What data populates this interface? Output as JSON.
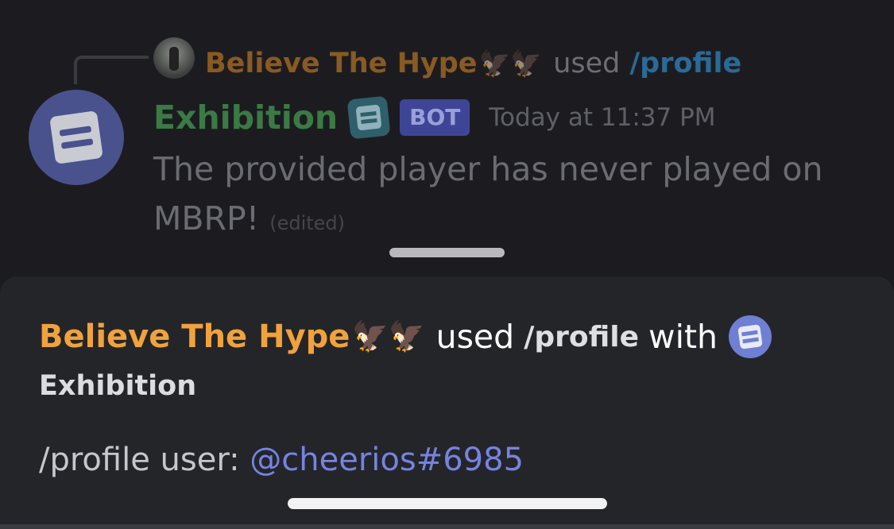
{
  "reply": {
    "user_name": "Believe The Hype",
    "user_emojis": "🦅🦅",
    "used_label": "used",
    "command": "/profile"
  },
  "message": {
    "bot_name": "Exhibition",
    "bot_tag": "BOT",
    "timestamp": "Today at 11:37 PM",
    "body_line1": "The provided player has never played on",
    "body_line2": "MBRP!",
    "edited_label": "(edited)"
  },
  "sheet": {
    "user_name": "Believe The Hype",
    "user_emojis": "🦅🦅",
    "used_label": "used",
    "command": "/profile",
    "with_label": "with",
    "app_name": "Exhibition",
    "command_line_prefix": "/profile user: ",
    "command_line_mention": "@cheerios#6985"
  },
  "colors": {
    "background": "#1c1c20",
    "sheet_background": "#242529",
    "bot_name": "#3b7a44",
    "user_name": "#f0a23c",
    "mention": "#7783e0",
    "bot_tag_bg": "#3e4597"
  },
  "icons": {
    "reply_avatar": "user-photo-avatar",
    "bot_avatar": "exhibition-logo",
    "bot_badge": "exhibition-badge-icon",
    "app_icon": "exhibition-app-icon"
  }
}
